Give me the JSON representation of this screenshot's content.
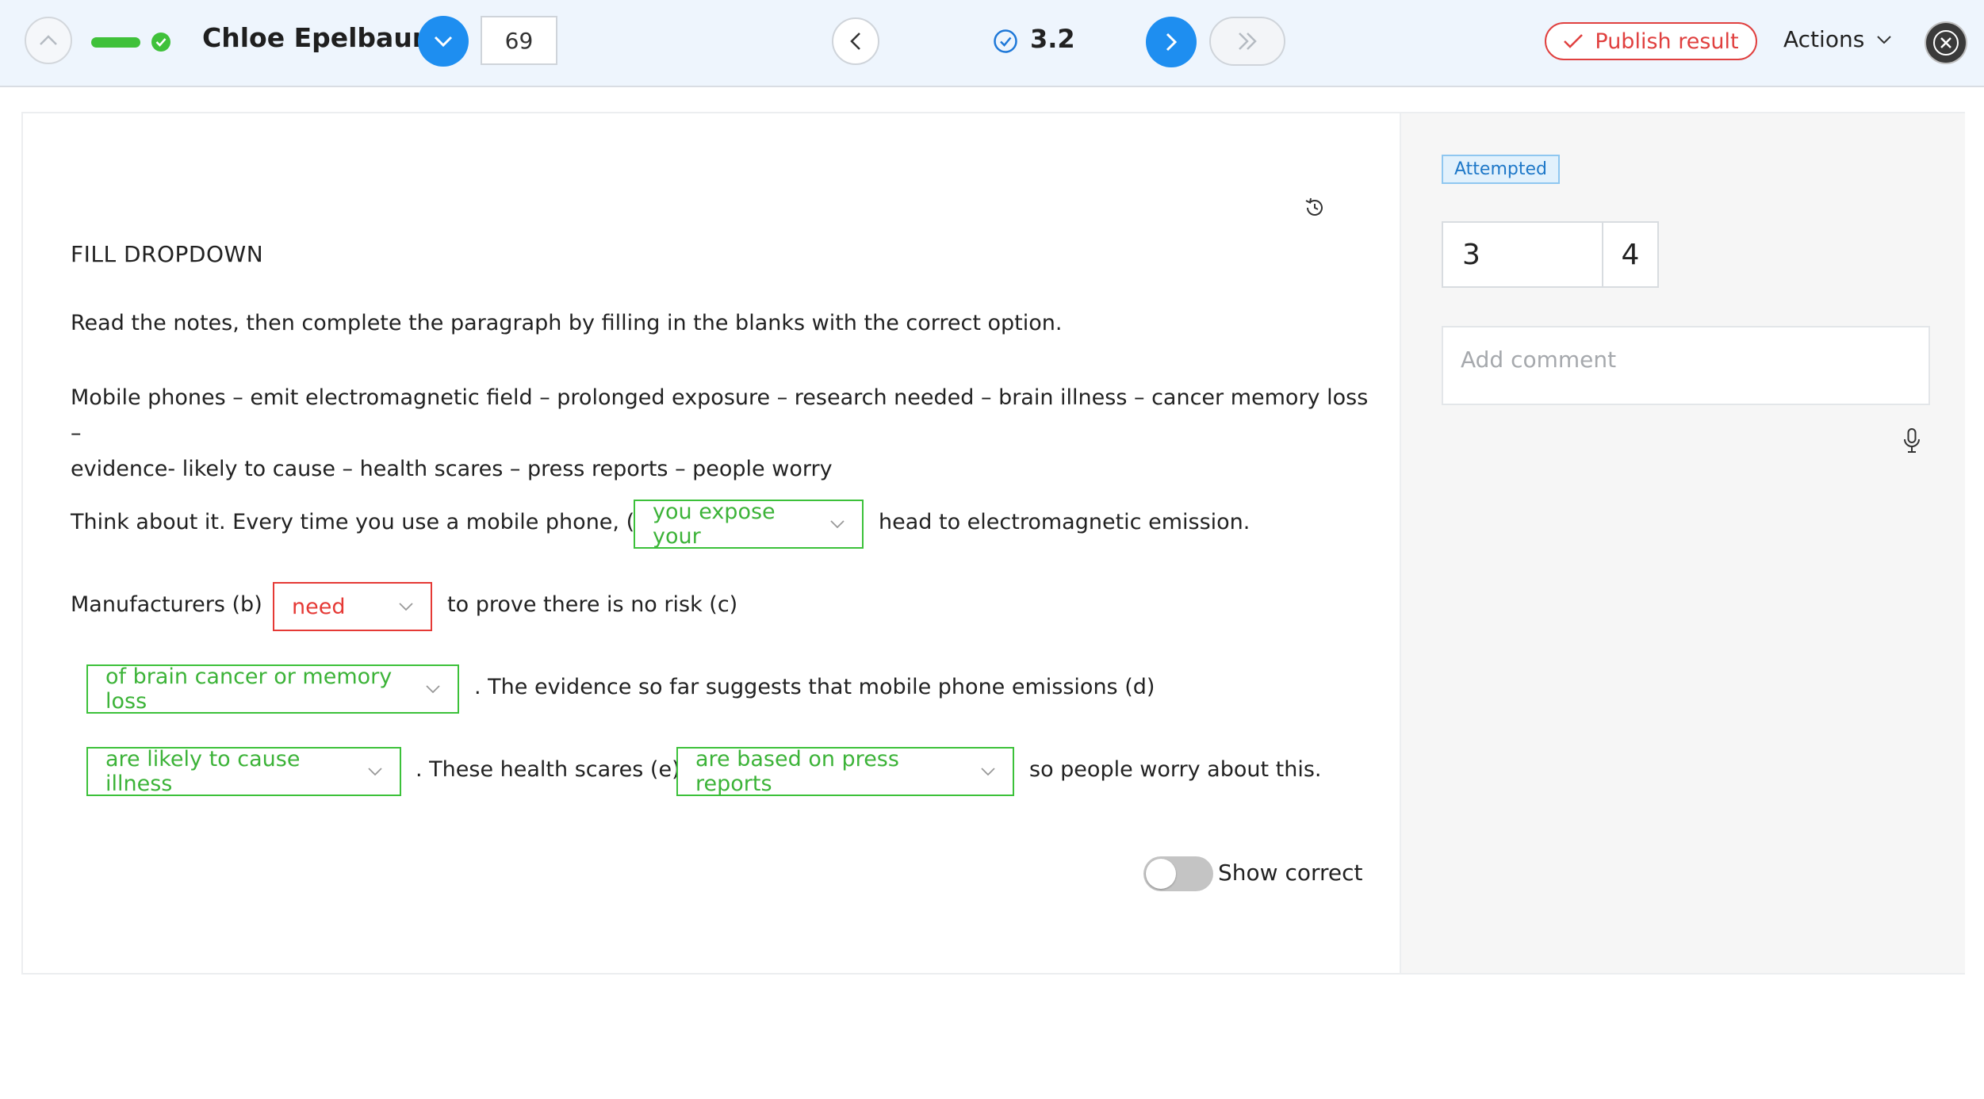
{
  "header": {
    "student_name": "Chloe Epelbaum",
    "student_number": "69",
    "question_number": "3.2",
    "publish_label": "Publish result",
    "actions_label": "Actions",
    "accent_color": "#1e8ef0",
    "success_color": "#3fc13a",
    "danger_color": "#e0403f"
  },
  "question": {
    "type_label": "FILL DROPDOWN",
    "instructions": "Read the notes, then complete the paragraph by filling in the blanks with the correct option.",
    "notes_line1": "Mobile phones – emit electromagnetic field – prolonged exposure – research needed – brain illness – cancer memory loss –",
    "notes_line2": "evidence- likely to cause – health scares – press reports – people worry",
    "text_a_pre": "Think about it. Every time you use a mobile phone, (a)",
    "answer_a": "you expose your",
    "text_a_post": "head to electromagnetic emission.",
    "text_b_pre": "Manufacturers (b)",
    "answer_b": "need",
    "text_b_post": "to prove there is no risk (c)",
    "answer_c": "of brain cancer or memory loss",
    "text_c_post": ". The evidence so far suggests that mobile phone emissions (d)",
    "answer_d": "are likely to cause illness",
    "text_d_post": ". These health scares (e)",
    "answer_e": "are based on press reports",
    "text_e_post": "so people worry about this.",
    "show_correct_label": "Show correct",
    "show_correct_on": false
  },
  "grading": {
    "status_badge": "Attempted",
    "score": "3",
    "max_score": "4",
    "comment_placeholder": "Add comment"
  }
}
